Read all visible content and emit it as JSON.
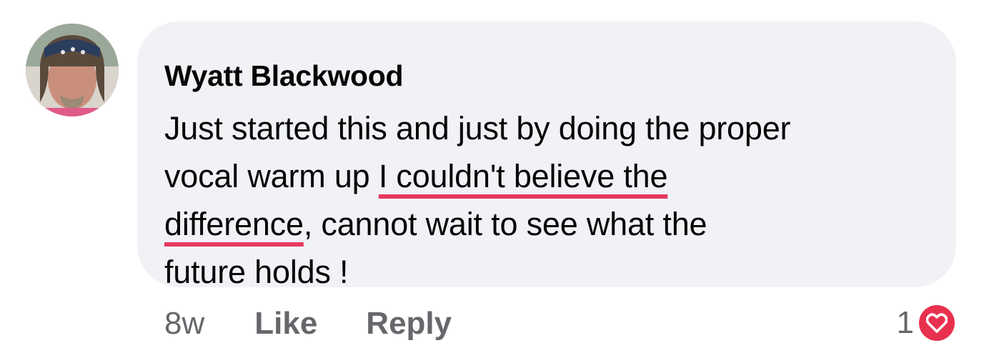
{
  "comment": {
    "author": "Wyatt Blackwood",
    "text_lines": [
      {
        "before": "Just started this and just by doing the proper",
        "highlight": "",
        "after": ""
      },
      {
        "before": "vocal warm up ",
        "highlight": "I couldn't believe the",
        "after": ""
      },
      {
        "before": "",
        "highlight": "difference",
        "after": ", cannot wait to see what the"
      },
      {
        "before": "future holds !",
        "highlight": "",
        "after": ""
      }
    ],
    "highlight_color": "#e63a62"
  },
  "actions": {
    "time": "8w",
    "like_label": "Like",
    "reply_label": "Reply"
  },
  "reactions": {
    "count": "1",
    "icon": "heart-icon",
    "color": "#e8304f"
  }
}
